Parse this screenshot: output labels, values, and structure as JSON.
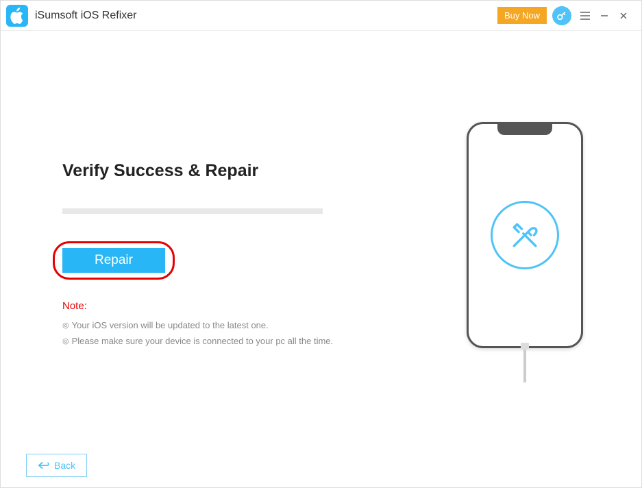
{
  "header": {
    "app_title": "iSumsoft iOS Refixer",
    "buy_now": "Buy Now"
  },
  "main": {
    "heading": "Verify Success & Repair",
    "repair_label": "Repair",
    "note_label": "Note:",
    "notes": [
      "Your iOS version will be updated to the latest one.",
      "Please make sure your device is connected to your pc all the time."
    ]
  },
  "footer": {
    "back_label": "Back"
  },
  "colors": {
    "accent": "#29b6f6",
    "warning": "#f5a623",
    "danger": "#e60000"
  }
}
